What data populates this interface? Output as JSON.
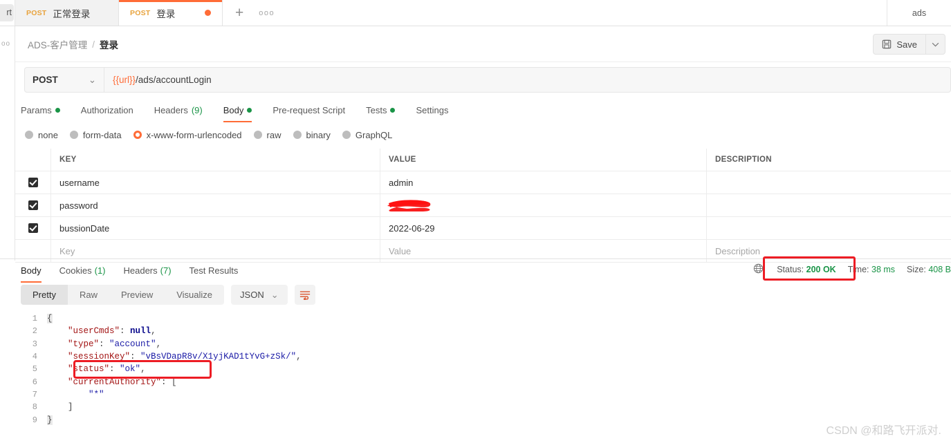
{
  "window": {
    "left_stub_label": "rt",
    "environment_label": "ads"
  },
  "tabs": [
    {
      "method": "POST",
      "name": "正常登录",
      "active": false,
      "unsaved": false
    },
    {
      "method": "POST",
      "name": "登录",
      "active": true,
      "unsaved": true
    }
  ],
  "tab_actions": {
    "new_tab": "+",
    "more": "ooo"
  },
  "breadcrumb": {
    "collection": "ADS-客户管理",
    "separator": "/",
    "request": "登录"
  },
  "toolbar": {
    "save_label": "Save",
    "save_caret": "⌄"
  },
  "url_bar": {
    "method": "POST",
    "method_caret": "⌄",
    "url_variable": "{{url}}",
    "url_path": "/ads/accountLogin"
  },
  "request_tabs": [
    {
      "label": "Params",
      "dot": true,
      "count": "",
      "active": false
    },
    {
      "label": "Authorization",
      "dot": false,
      "count": "",
      "active": false
    },
    {
      "label": "Headers",
      "dot": false,
      "count": "(9)",
      "active": false
    },
    {
      "label": "Body",
      "dot": true,
      "count": "",
      "active": true
    },
    {
      "label": "Pre-request Script",
      "dot": false,
      "count": "",
      "active": false
    },
    {
      "label": "Tests",
      "dot": true,
      "count": "",
      "active": false
    },
    {
      "label": "Settings",
      "dot": false,
      "count": "",
      "active": false
    }
  ],
  "body_types": [
    {
      "label": "none",
      "selected": false
    },
    {
      "label": "form-data",
      "selected": false
    },
    {
      "label": "x-www-form-urlencoded",
      "selected": true
    },
    {
      "label": "raw",
      "selected": false
    },
    {
      "label": "binary",
      "selected": false
    },
    {
      "label": "GraphQL",
      "selected": false
    }
  ],
  "param_table": {
    "headers": {
      "key": "KEY",
      "value": "VALUE",
      "description": "DESCRIPTION"
    },
    "rows": [
      {
        "checked": true,
        "key": "username",
        "value": "admin",
        "description": ""
      },
      {
        "checked": true,
        "key": "password",
        "value": "",
        "description": "",
        "redacted": true
      },
      {
        "checked": true,
        "key": "bussionDate",
        "value": "2022-06-29",
        "description": ""
      }
    ],
    "placeholder_row": {
      "key": "Key",
      "value": "Value",
      "description": "Description"
    }
  },
  "response_tabs": [
    {
      "label": "Body",
      "count": "",
      "active": true
    },
    {
      "label": "Cookies",
      "count": "(1)",
      "active": false
    },
    {
      "label": "Headers",
      "count": "(7)",
      "active": false
    },
    {
      "label": "Test Results",
      "count": "",
      "active": false
    }
  ],
  "response_status": {
    "globe_icon": "globe-icon",
    "status_label": "Status:",
    "status_value": "200 OK",
    "time_label": "Time:",
    "time_value": "38 ms",
    "size_label": "Size:",
    "size_value": "408 B"
  },
  "view_toolbar": {
    "segments": [
      {
        "label": "Pretty",
        "active": true
      },
      {
        "label": "Raw",
        "active": false
      },
      {
        "label": "Preview",
        "active": false
      },
      {
        "label": "Visualize",
        "active": false
      }
    ],
    "format": "JSON",
    "format_caret": "⌄",
    "wrap_icon": "wrap-lines-icon"
  },
  "response_body": {
    "lines": [
      {
        "n": "1",
        "segments": [
          {
            "t": "{",
            "c": "brk"
          }
        ]
      },
      {
        "n": "2",
        "segments": [
          {
            "t": "    ",
            "c": "p"
          },
          {
            "t": "\"userCmds\"",
            "c": "k"
          },
          {
            "t": ": ",
            "c": "p"
          },
          {
            "t": "null",
            "c": "nul"
          },
          {
            "t": ",",
            "c": "p"
          }
        ]
      },
      {
        "n": "3",
        "segments": [
          {
            "t": "    ",
            "c": "p"
          },
          {
            "t": "\"type\"",
            "c": "k"
          },
          {
            "t": ": ",
            "c": "p"
          },
          {
            "t": "\"account\"",
            "c": "s"
          },
          {
            "t": ",",
            "c": "p"
          }
        ]
      },
      {
        "n": "4",
        "segments": [
          {
            "t": "    ",
            "c": "p"
          },
          {
            "t": "\"sessionKey\"",
            "c": "k"
          },
          {
            "t": ": ",
            "c": "p"
          },
          {
            "t": "\"vBsVDapR8v/X1yjKAD1tYvG+zSk/\"",
            "c": "s"
          },
          {
            "t": ",",
            "c": "p"
          }
        ]
      },
      {
        "n": "5",
        "segments": [
          {
            "t": "    ",
            "c": "p"
          },
          {
            "t": "\"status\"",
            "c": "k"
          },
          {
            "t": ": ",
            "c": "p"
          },
          {
            "t": "\"ok\"",
            "c": "s"
          },
          {
            "t": ",",
            "c": "p"
          }
        ]
      },
      {
        "n": "6",
        "segments": [
          {
            "t": "    ",
            "c": "p"
          },
          {
            "t": "\"currentAuthority\"",
            "c": "k"
          },
          {
            "t": ": [",
            "c": "p"
          }
        ]
      },
      {
        "n": "7",
        "segments": [
          {
            "t": "        ",
            "c": "p"
          },
          {
            "t": "\"*\"",
            "c": "s"
          }
        ]
      },
      {
        "n": "8",
        "segments": [
          {
            "t": "    ]",
            "c": "p"
          }
        ]
      },
      {
        "n": "9",
        "segments": [
          {
            "t": "}",
            "c": "brk"
          }
        ]
      }
    ]
  },
  "annotations": {
    "highlight_color": "#ed1c24",
    "status_box": "200 OK highlight",
    "json_box": "status ok highlight",
    "redaction": "password value redacted"
  },
  "watermark": "CSDN @和路飞开派对.",
  "colors": {
    "accent": "#ff6c37",
    "success": "#1a9447",
    "method": "#e8a33d",
    "annotation": "#ed1c24"
  }
}
